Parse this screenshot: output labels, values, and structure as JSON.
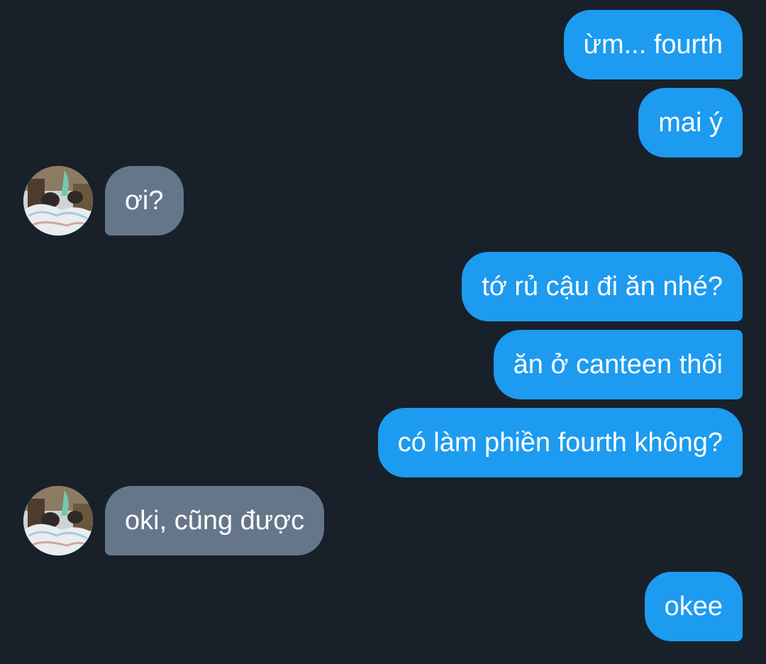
{
  "conversation": {
    "messages": [
      {
        "sender": "me",
        "text": "ừm... fourth"
      },
      {
        "sender": "me",
        "text": "mai ý"
      },
      {
        "sender": "contact",
        "text": "ơi?"
      },
      {
        "sender": "me",
        "text": "tớ rủ cậu đi ăn nhé?"
      },
      {
        "sender": "me",
        "text": "ăn ở canteen thôi"
      },
      {
        "sender": "me",
        "text": "có làm phiền fourth không?"
      },
      {
        "sender": "contact",
        "text": "oki, cũng được"
      },
      {
        "sender": "me",
        "text": "okee"
      }
    ]
  },
  "theme": {
    "background": "#18202a",
    "outgoing_bubble": "#1d9bf0",
    "incoming_bubble": "#66768a",
    "text": "#ffffff"
  },
  "contact": {
    "avatar_icon": "contact-avatar-photo"
  }
}
